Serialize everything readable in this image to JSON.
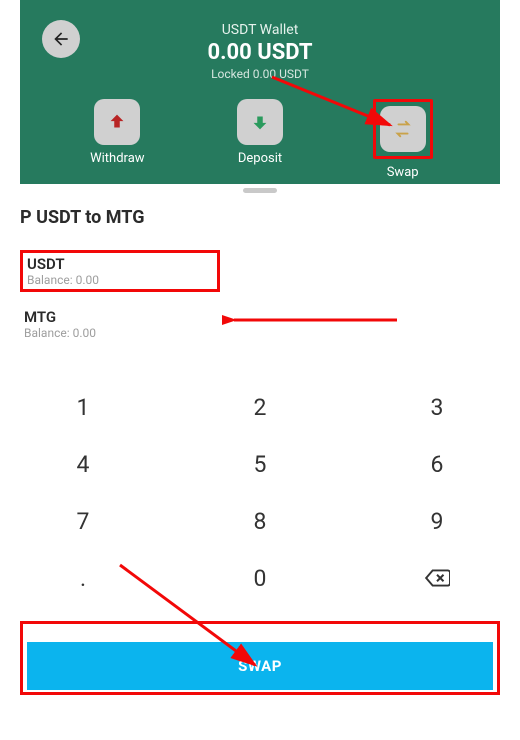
{
  "header": {
    "wallet_title": "USDT Wallet",
    "balance": "0.00 USDT",
    "locked": "Locked 0.00 USDT"
  },
  "actions": {
    "withdraw": "Withdraw",
    "deposit": "Deposit",
    "swap": "Swap"
  },
  "sheet": {
    "title": "P USDT to MTG",
    "from_currency": "USDT",
    "from_balance": "Balance: 0.00",
    "to_currency": "MTG",
    "to_balance": "Balance: 0.00"
  },
  "keypad": {
    "k1": "1",
    "k2": "2",
    "k3": "3",
    "k4": "4",
    "k5": "5",
    "k6": "6",
    "k7": "7",
    "k8": "8",
    "k9": "9",
    "kdot": ".",
    "k0": "0"
  },
  "swap_btn": "SWAP"
}
